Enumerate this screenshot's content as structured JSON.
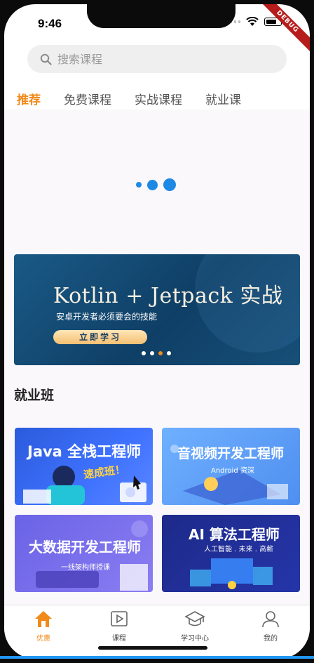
{
  "status": {
    "time": "9:46",
    "debug_label": "DEBUG"
  },
  "search": {
    "placeholder": "搜索课程"
  },
  "tabs": [
    {
      "label": "推荐"
    },
    {
      "label": "免费课程"
    },
    {
      "label": "实战课程"
    },
    {
      "label": "就业课"
    }
  ],
  "banner": {
    "title": "Kotlin + Jetpack 实战",
    "subtitle": "安卓开发者必须要会的技能",
    "button": "立即学习"
  },
  "section": {
    "title": "就业班"
  },
  "cards": [
    {
      "title": "Java 全栈工程师",
      "subtitle": "速成班！"
    },
    {
      "title": "音视频开发工程师",
      "subtitle": "Android 资深"
    },
    {
      "title": "大数据开发工程师",
      "subtitle": "一线架构师授课"
    },
    {
      "title": "AI 算法工程师",
      "subtitle": "人工智能 . 未来 . 高薪"
    }
  ],
  "bottom_nav": [
    {
      "label": "优惠",
      "icon": "home-icon"
    },
    {
      "label": "课程",
      "icon": "play-icon"
    },
    {
      "label": "学习中心",
      "icon": "graduation-cap-icon"
    },
    {
      "label": "我的",
      "icon": "user-icon"
    }
  ],
  "colors": {
    "accent": "#f08a1a",
    "loader": "#1e88e5"
  }
}
